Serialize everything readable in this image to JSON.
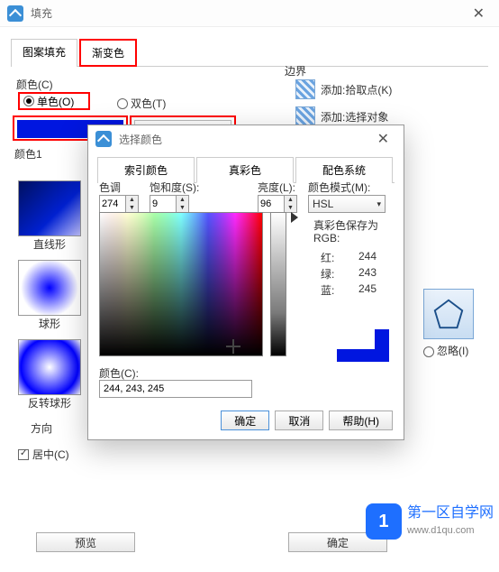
{
  "parent": {
    "title": "填充",
    "tabs": [
      "图案填充",
      "渐变色"
    ],
    "color_label": "颜色(C)",
    "radio_single": "单色(O)",
    "radio_double": "双色(T)",
    "color1_label": "颜色1",
    "shapes": {
      "linear": "直线形",
      "sphere": "球形",
      "revsphere": "反转球形"
    },
    "direction_label": "方向",
    "centered": "居中(C)",
    "border_label": "边界",
    "add_pick": "添加:拾取点(K)",
    "add_select": "添加:选择对象",
    "ignore": "忽略(I)",
    "preview": "预览",
    "ok": "确定"
  },
  "picker": {
    "title": "选择颜色",
    "tabs": [
      "索引颜色",
      "真彩色",
      "配色系统"
    ],
    "hue_label": "色调",
    "sat_label": "饱和度(S):",
    "lum_label": "亮度(L):",
    "mode_label": "颜色模式(M):",
    "hue": "274",
    "sat": "9",
    "lum": "96",
    "mode": "HSL",
    "saveas": "真彩色保存为",
    "rgb": "RGB:",
    "red_label": "红:",
    "green_label": "绿:",
    "blue_label": "蓝:",
    "red": "244",
    "green": "243",
    "blue": "245",
    "color_field_label": "颜色(C):",
    "color_field": "244, 243, 245",
    "ok": "确定",
    "cancel": "取消",
    "help": "帮助(H)"
  },
  "watermark": {
    "line1": "第一区自学网",
    "line2": "www.d1qu.com"
  }
}
